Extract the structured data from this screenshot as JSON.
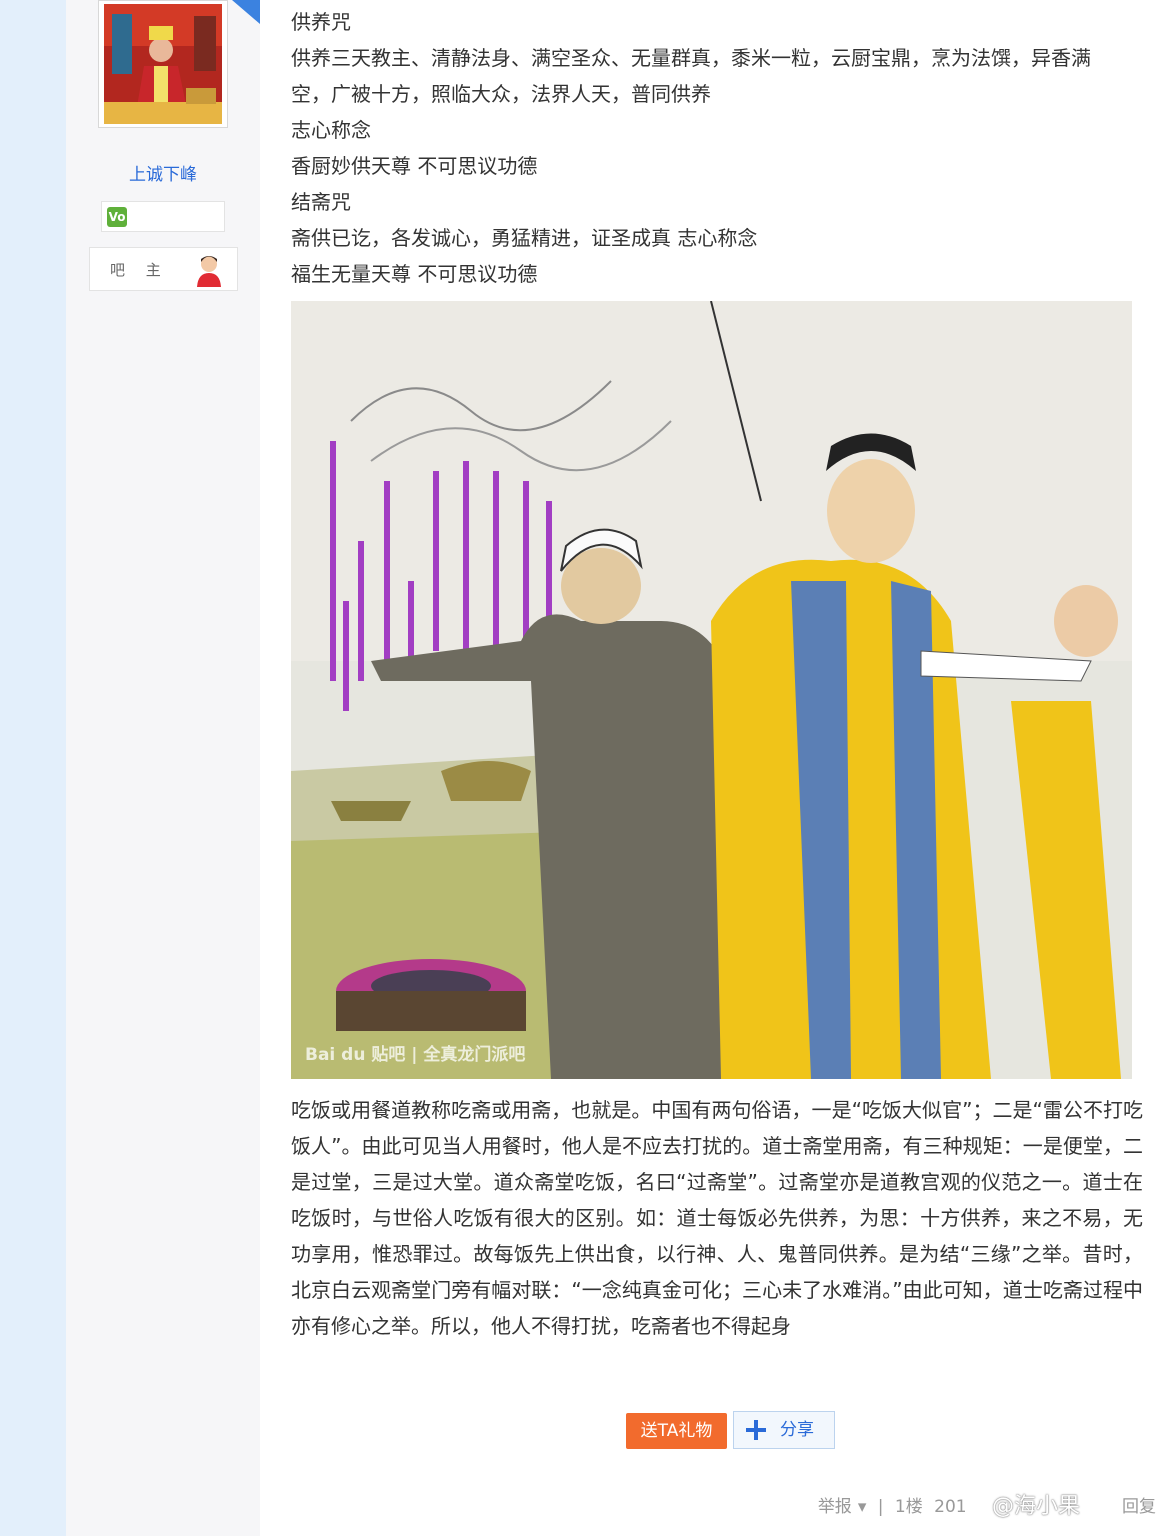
{
  "sidebar": {
    "username": "上诚下峰",
    "level_badge": "Vo",
    "owner_label": "吧 主"
  },
  "post": {
    "lines": [
      "供养咒",
      "供养三天教主、清静法身、满空圣众、无量群真，黍米一粒，云厨宝鼎，烹为法馔，异香满",
      "空，广被十方，照临大众，法界人天，普同供养",
      "志心称念",
      "香厨妙供天尊 不可思议功德",
      "结斋咒",
      "斋供已讫，各发诚心，勇猛精进，证圣成真 志心称念",
      "福生无量天尊 不可思议功德"
    ],
    "image_watermark": "Bai du 贴吧 | 全真龙门派吧",
    "paragraph": "吃饭或用餐道教称吃斋或用斋，也就是。中国有两句俗语，一是“吃饭大似官”；二是“雷公不打吃饭人”。由此可见当人用餐时，他人是不应去打扰的。道士斋堂用斋，有三种规矩：一是便堂，二是过堂，三是过大堂。道众斋堂吃饭，名曰“过斋堂”。过斋堂亦是道教宫观的仪范之一。道士在吃饭时，与世俗人吃饭有很大的区别。如：道士每饭必先供养，为思：十方供养，来之不易，无功享用，惟恐罪过。故每饭先上供出食，以行神、人、鬼普同供养。是为结“三缘”之举。昔时，北京白云观斋堂门旁有幅对联：“一念纯真金可化；三心未了水难消。”由此可知，道士吃斋过程中亦有修心之举。所以，他人不得打扰，吃斋者也不得起身"
  },
  "actions": {
    "gift": "送TA礼物",
    "share": "分享"
  },
  "footer": {
    "report": "举报",
    "floor": "1楼",
    "date": "201",
    "reply": "回复"
  },
  "overlay": {
    "weibo": "@海小果"
  },
  "colors": {
    "accent_blue": "#2a6ad8",
    "gift_orange": "#f26b2d",
    "page_bg": "#e3effb"
  }
}
